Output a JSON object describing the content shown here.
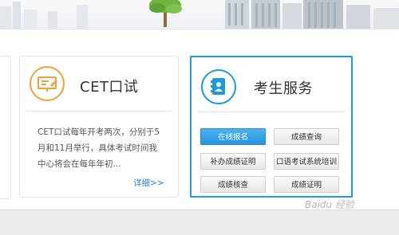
{
  "cards": {
    "cet": {
      "title": "CET口试",
      "description": "CET口试每年开考两次，分别于5月和11月举行，具体考试时间我中心将会在每年年初...",
      "more_link": "详细>>"
    },
    "service": {
      "title": "考生服务",
      "buttons": [
        {
          "label": "在线报名",
          "primary": true
        },
        {
          "label": "成绩查询",
          "primary": false
        },
        {
          "label": "补办成绩证明",
          "primary": false
        },
        {
          "label": "口语考试系统培训",
          "primary": false
        },
        {
          "label": "成绩核查",
          "primary": false
        },
        {
          "label": "成绩证明",
          "primary": false
        }
      ]
    }
  },
  "watermark": "Baidu 经验",
  "colors": {
    "accent_blue": "#2a9ad6",
    "cet_orange": "#f0a23a",
    "primary_button": "#3aa6e8"
  },
  "icons": {
    "cet": "presentation-board-icon",
    "service": "contact-book-icon"
  }
}
